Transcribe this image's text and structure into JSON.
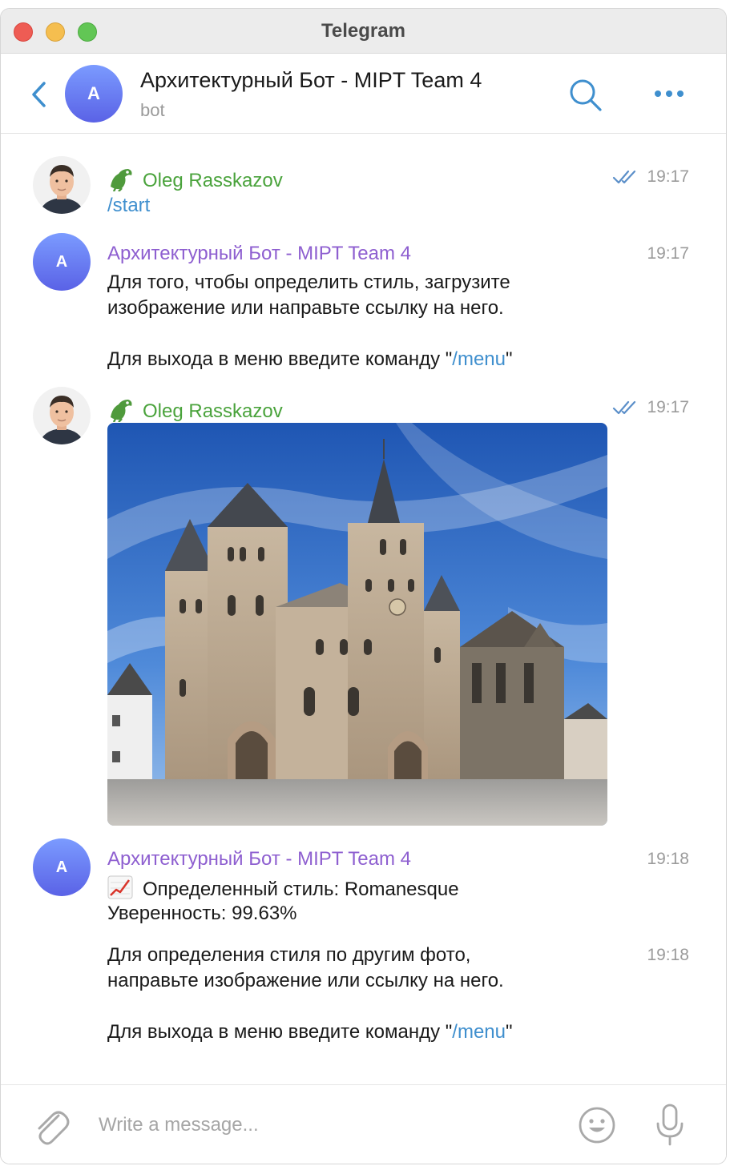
{
  "window": {
    "title": "Telegram"
  },
  "header": {
    "avatar_letter": "A",
    "title": "Архитектурный Бот - MIPT Team 4",
    "subtitle": "bot"
  },
  "messages": [
    {
      "sender": "Oleg Rasskazov",
      "time": "19:17",
      "text": "/start"
    },
    {
      "sender": "Архитектурный Бот - MIPT Team 4",
      "avatar_letter": "A",
      "time": "19:17",
      "line1": "Для того, чтобы определить стиль, загрузите",
      "line2": "изображение или направьте ссылку на него.",
      "line3_prefix": "Для выхода в меню введите команду \"",
      "line3_link": "/menu",
      "line3_suffix": "\""
    },
    {
      "sender": "Oleg Rasskazov",
      "time": "19:17"
    },
    {
      "sender": "Архитектурный Бот - MIPT Team 4",
      "avatar_letter": "A",
      "time": "19:18",
      "line1": "Определенный стиль: Romanesque",
      "line2": "Уверенность: 99.63%"
    },
    {
      "time": "19:18",
      "line1": "Для определения стиля по другим фото,",
      "line2": "направьте изображение или ссылку на него.",
      "line3_prefix": "Для выхода в меню введите команду \"",
      "line3_link": "/menu",
      "line3_suffix": "\""
    }
  ],
  "composer": {
    "placeholder": "Write a message..."
  },
  "colors": {
    "accent": "#3f8fce",
    "user_name": "#4aa33c",
    "bot_name": "#8e5fd0",
    "check": "#5b8fc9"
  },
  "icons": [
    "back-arrow-icon",
    "search-icon",
    "more-icon",
    "croc-emoji-icon",
    "double-check-icon",
    "chart-emoji-icon",
    "attach-icon",
    "emoji-icon",
    "microphone-icon"
  ]
}
